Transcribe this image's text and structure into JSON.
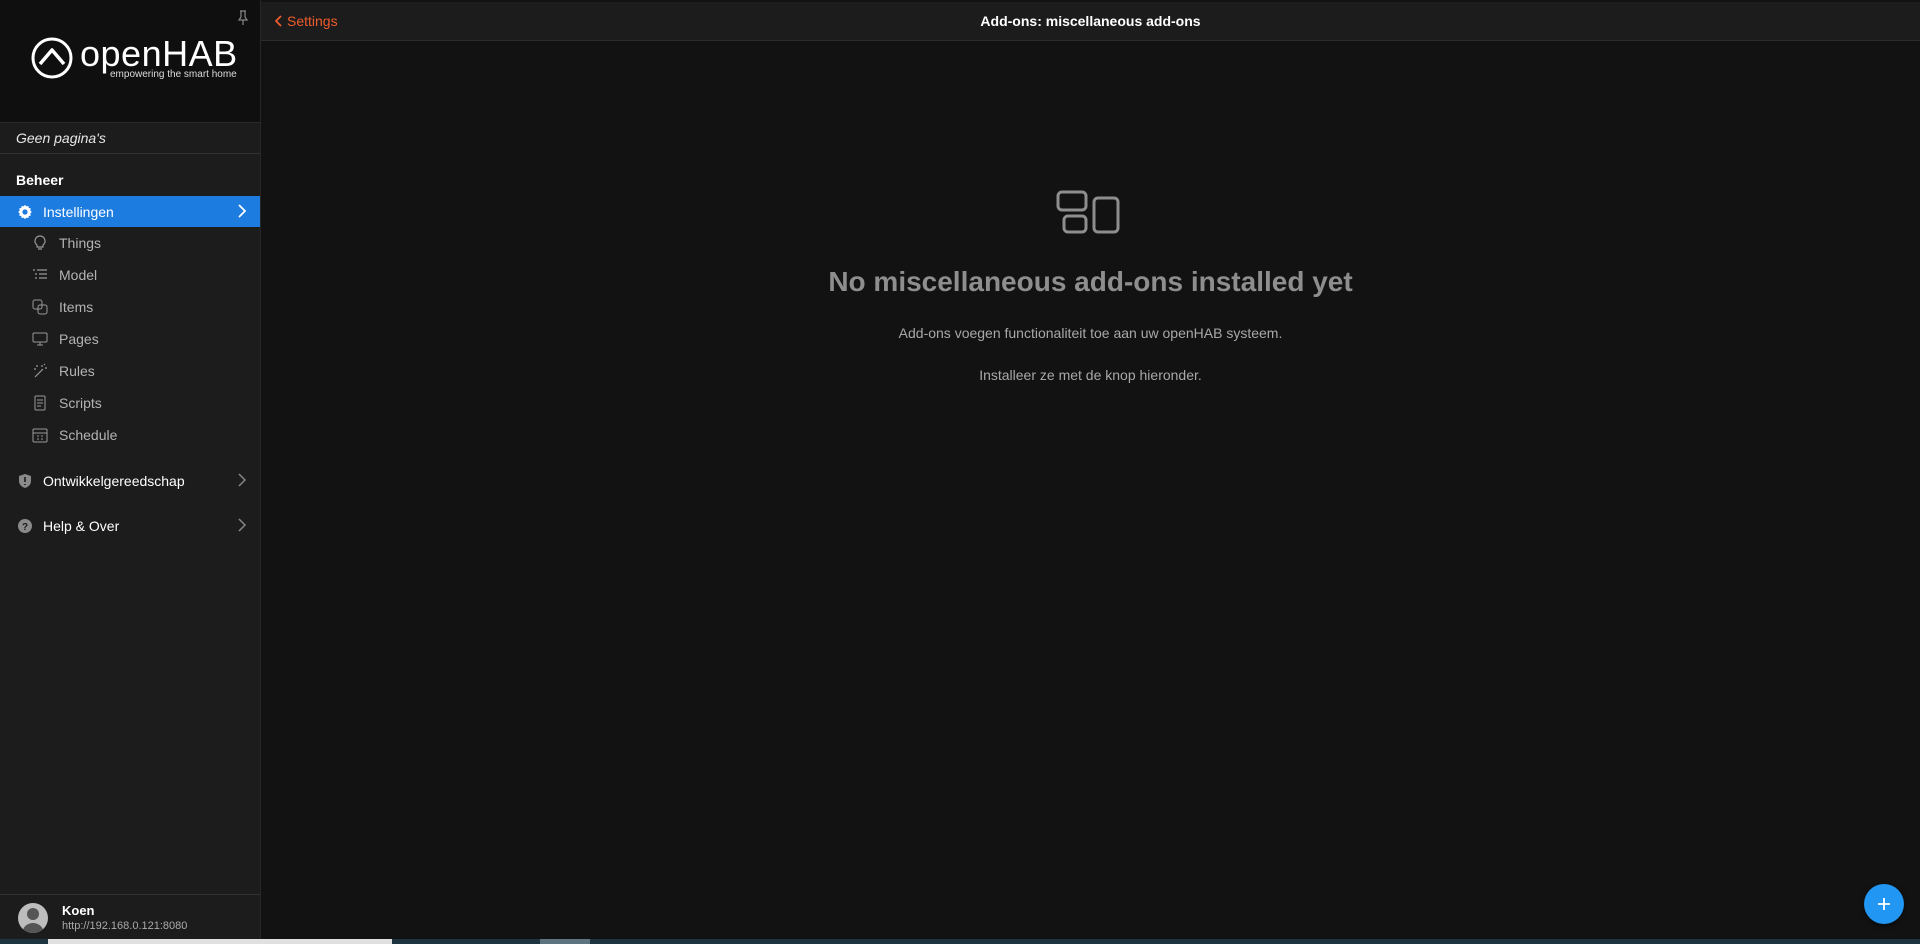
{
  "sidebar": {
    "logo": {
      "name": "openHAB",
      "tagline": "empowering the smart home"
    },
    "no_pages": "Geen pagina's",
    "section_title": "Beheer",
    "settings": {
      "label": "Instellingen",
      "icon": "gear-icon"
    },
    "sub_items": [
      {
        "label": "Things",
        "icon": "lightbulb-icon"
      },
      {
        "label": "Model",
        "icon": "list-tree-icon"
      },
      {
        "label": "Items",
        "icon": "items-square-icon"
      },
      {
        "label": "Pages",
        "icon": "monitor-icon"
      },
      {
        "label": "Rules",
        "icon": "wand-icon"
      },
      {
        "label": "Scripts",
        "icon": "document-icon"
      },
      {
        "label": "Schedule",
        "icon": "calendar-icon"
      }
    ],
    "developer_tools": {
      "label": "Ontwikkelgereedschap",
      "icon": "shield-icon"
    },
    "help": {
      "label": "Help & Over",
      "icon": "question-circle-icon"
    },
    "user": {
      "name": "Koen",
      "url": "http://192.168.0.121:8080"
    }
  },
  "topbar": {
    "back_label": "Settings",
    "title": "Add-ons: miscellaneous add-ons"
  },
  "empty_state": {
    "icon": "addons-blocks-icon",
    "title": "No miscellaneous add-ons installed yet",
    "line1": "Add-ons voegen functionaliteit toe aan uw openHAB systeem.",
    "line2": "Installeer ze met de knop hieronder."
  },
  "fab": {
    "icon": "plus-icon"
  },
  "colors": {
    "accent": "#1c7ce0",
    "back_link": "#ee5b2c",
    "fab": "#2196f3",
    "background": "#121212",
    "sidebar": "#1c1c1d"
  }
}
